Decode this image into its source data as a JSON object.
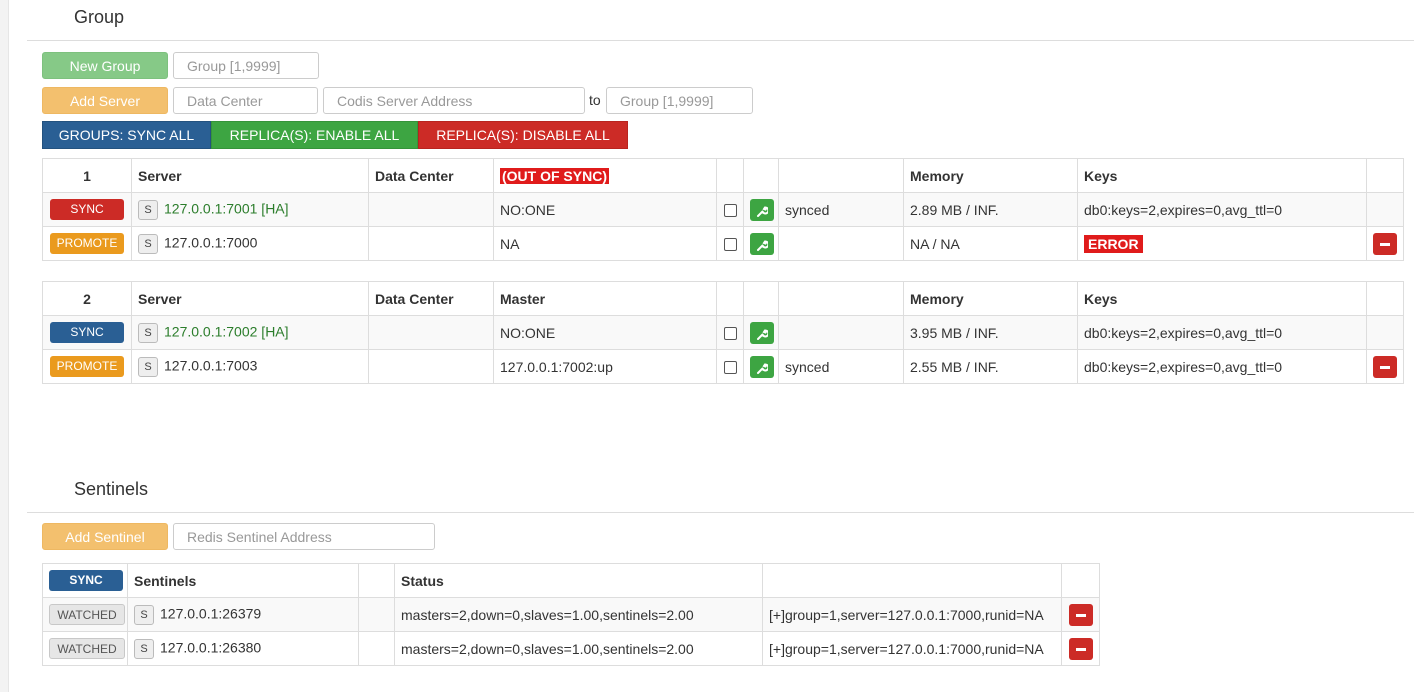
{
  "group_section": {
    "title": "Group",
    "new_group_label": "New Group",
    "group_placeholder": "Group [1,9999]",
    "add_server_label": "Add Server",
    "datacenter_placeholder": "Data Center",
    "codis_addr_placeholder": "Codis Server Address",
    "to_label": "to",
    "target_group_placeholder": "Group [1,9999]",
    "sync_all_label": "GROUPS: SYNC ALL",
    "enable_all_label": "REPLICA(S): ENABLE ALL",
    "disable_all_label": "REPLICA(S): DISABLE ALL"
  },
  "groups": [
    {
      "id": "1",
      "headers": {
        "server": "Server",
        "datacenter": "Data Center",
        "master": "(OUT OF SYNC)",
        "memory": "Memory",
        "keys": "Keys"
      },
      "rows": [
        {
          "action": "SYNC",
          "s": "S",
          "server": "127.0.0.1:7001 [HA]",
          "datacenter": "",
          "master": "NO:ONE",
          "status": "synced",
          "memory": "2.89 MB / INF.",
          "keys": "db0:keys=2,expires=0,avg_ttl=0"
        },
        {
          "action": "PROMOTE",
          "s": "S",
          "server": "127.0.0.1:7000",
          "datacenter": "",
          "master": "NA",
          "status": "",
          "memory": "NA / NA",
          "keys": "ERROR"
        }
      ]
    },
    {
      "id": "2",
      "headers": {
        "server": "Server",
        "datacenter": "Data Center",
        "master": "Master",
        "memory": "Memory",
        "keys": "Keys"
      },
      "rows": [
        {
          "action": "SYNC",
          "s": "S",
          "server": "127.0.0.1:7002 [HA]",
          "datacenter": "",
          "master": "NO:ONE",
          "status": "",
          "memory": "3.95 MB / INF.",
          "keys": "db0:keys=2,expires=0,avg_ttl=0"
        },
        {
          "action": "PROMOTE",
          "s": "S",
          "server": "127.0.0.1:7003",
          "datacenter": "",
          "master": "127.0.0.1:7002:up",
          "status": "synced",
          "memory": "2.55 MB / INF.",
          "keys": "db0:keys=2,expires=0,avg_ttl=0"
        }
      ]
    }
  ],
  "sentinel_section": {
    "title": "Sentinels",
    "add_sentinel_label": "Add Sentinel",
    "sentinel_addr_placeholder": "Redis Sentinel Address",
    "headers": {
      "sync": "SYNC",
      "sentinels": "Sentinels",
      "status": "Status"
    },
    "rows": [
      {
        "state": "WATCHED",
        "s": "S",
        "address": "127.0.0.1:26379",
        "status": "masters=2,down=0,slaves=1.00,sentinels=2.00",
        "note": "[+]group=1,server=127.0.0.1:7000,runid=NA"
      },
      {
        "state": "WATCHED",
        "s": "S",
        "address": "127.0.0.1:26380",
        "status": "masters=2,down=0,slaves=1.00,sentinels=2.00",
        "note": "[+]group=1,server=127.0.0.1:7000,runid=NA"
      }
    ]
  },
  "colors": {
    "sync_red": "#cc2b26",
    "promote_orange": "#ea9a1e",
    "sync_blue": "#2a5f94",
    "ok_green": "#3da542",
    "error_red": "#e01b1b"
  },
  "icons": {
    "wrench": "wrench-icon",
    "remove": "minus-icon"
  }
}
